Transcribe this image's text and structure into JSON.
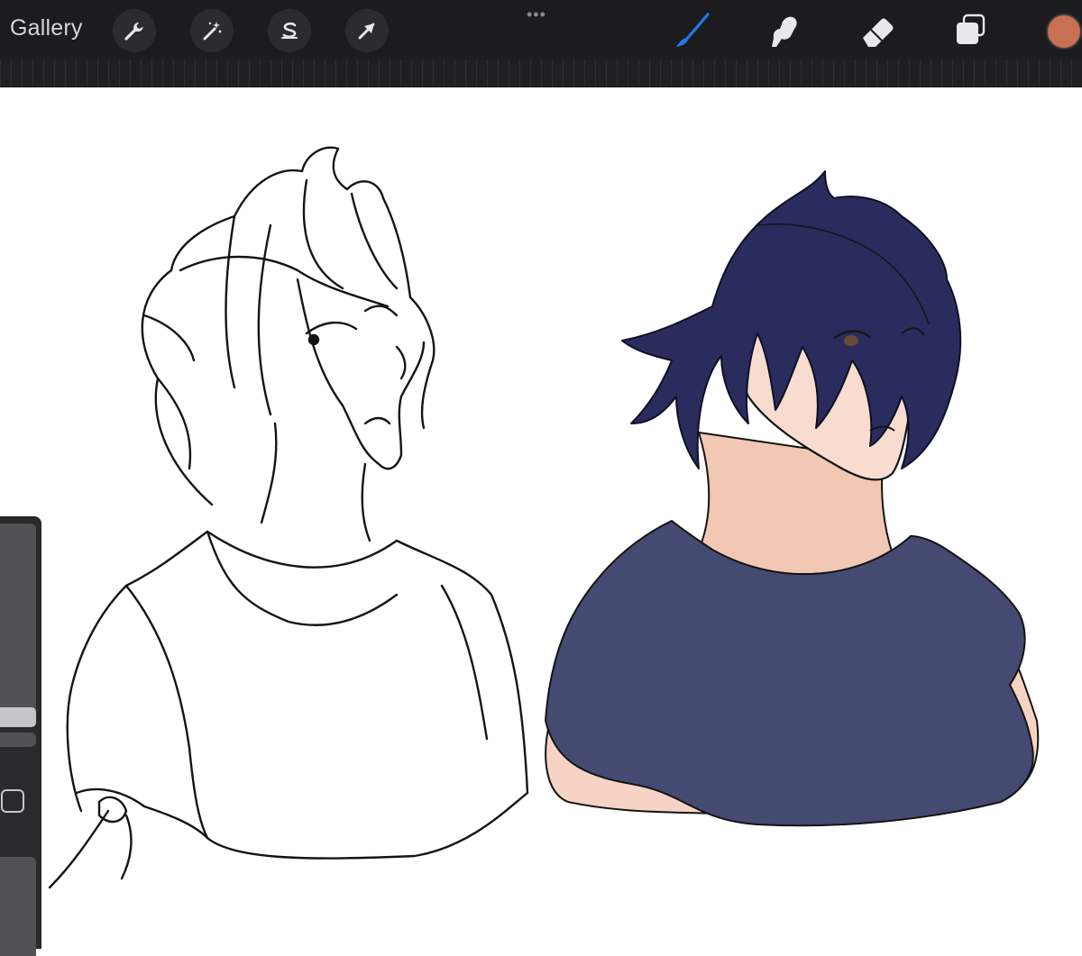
{
  "toolbar": {
    "gallery_label": "Gallery",
    "more_label": "•••",
    "left_tools": [
      {
        "name": "actions",
        "icon": "wrench-icon"
      },
      {
        "name": "adjustments",
        "icon": "magic-wand-icon"
      },
      {
        "name": "selection",
        "icon": "selection-s-icon"
      },
      {
        "name": "transform",
        "icon": "arrow-cursor-icon"
      }
    ],
    "right_tools": [
      {
        "name": "brush",
        "icon": "brush-icon",
        "active": true
      },
      {
        "name": "smudge",
        "icon": "smudge-icon"
      },
      {
        "name": "eraser",
        "icon": "eraser-icon"
      },
      {
        "name": "layers",
        "icon": "layers-icon"
      }
    ],
    "current_color": "#c96f54",
    "active_tool_color": "#1e7bf0"
  },
  "canvas": {
    "artwork_left": "line-art-character-sketch",
    "artwork_right": "colored-character-navy-hair",
    "palette": {
      "hair": "#2a2c5e",
      "shirt": "#454a72",
      "skin": "#f6d3c4",
      "line": "#141414"
    }
  },
  "sidebar": {
    "brush_size_level": 0.05,
    "opacity_level": 1.0
  }
}
